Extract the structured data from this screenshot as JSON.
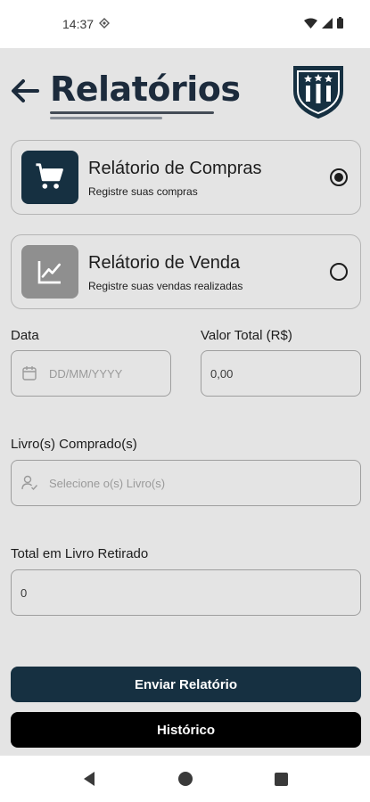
{
  "status_bar": {
    "time": "14:37"
  },
  "header": {
    "title": "Relatórios"
  },
  "reports": {
    "compras": {
      "title": "Relátorio de Compras",
      "subtitle": "Registre suas compras",
      "selected": true,
      "icon_color": "#163041"
    },
    "venda": {
      "title": "Relátorio de Venda",
      "subtitle": "Registre suas vendas realizadas",
      "selected": false,
      "icon_color": "#8f8f8f"
    }
  },
  "form": {
    "data": {
      "label": "Data",
      "placeholder": "DD/MM/YYYY"
    },
    "valor_total": {
      "label": "Valor Total (R$)",
      "value": "0,00"
    },
    "livros": {
      "label": "Livro(s) Comprado(s)",
      "placeholder": "Selecione o(s) Livro(s)"
    },
    "total_retirado": {
      "label": "Total em Livro Retirado",
      "value": "0"
    }
  },
  "buttons": {
    "enviar": "Enviar Relatório",
    "historico": "Histórico"
  },
  "colors": {
    "primary": "#163041",
    "background": "#e4e4e4"
  }
}
